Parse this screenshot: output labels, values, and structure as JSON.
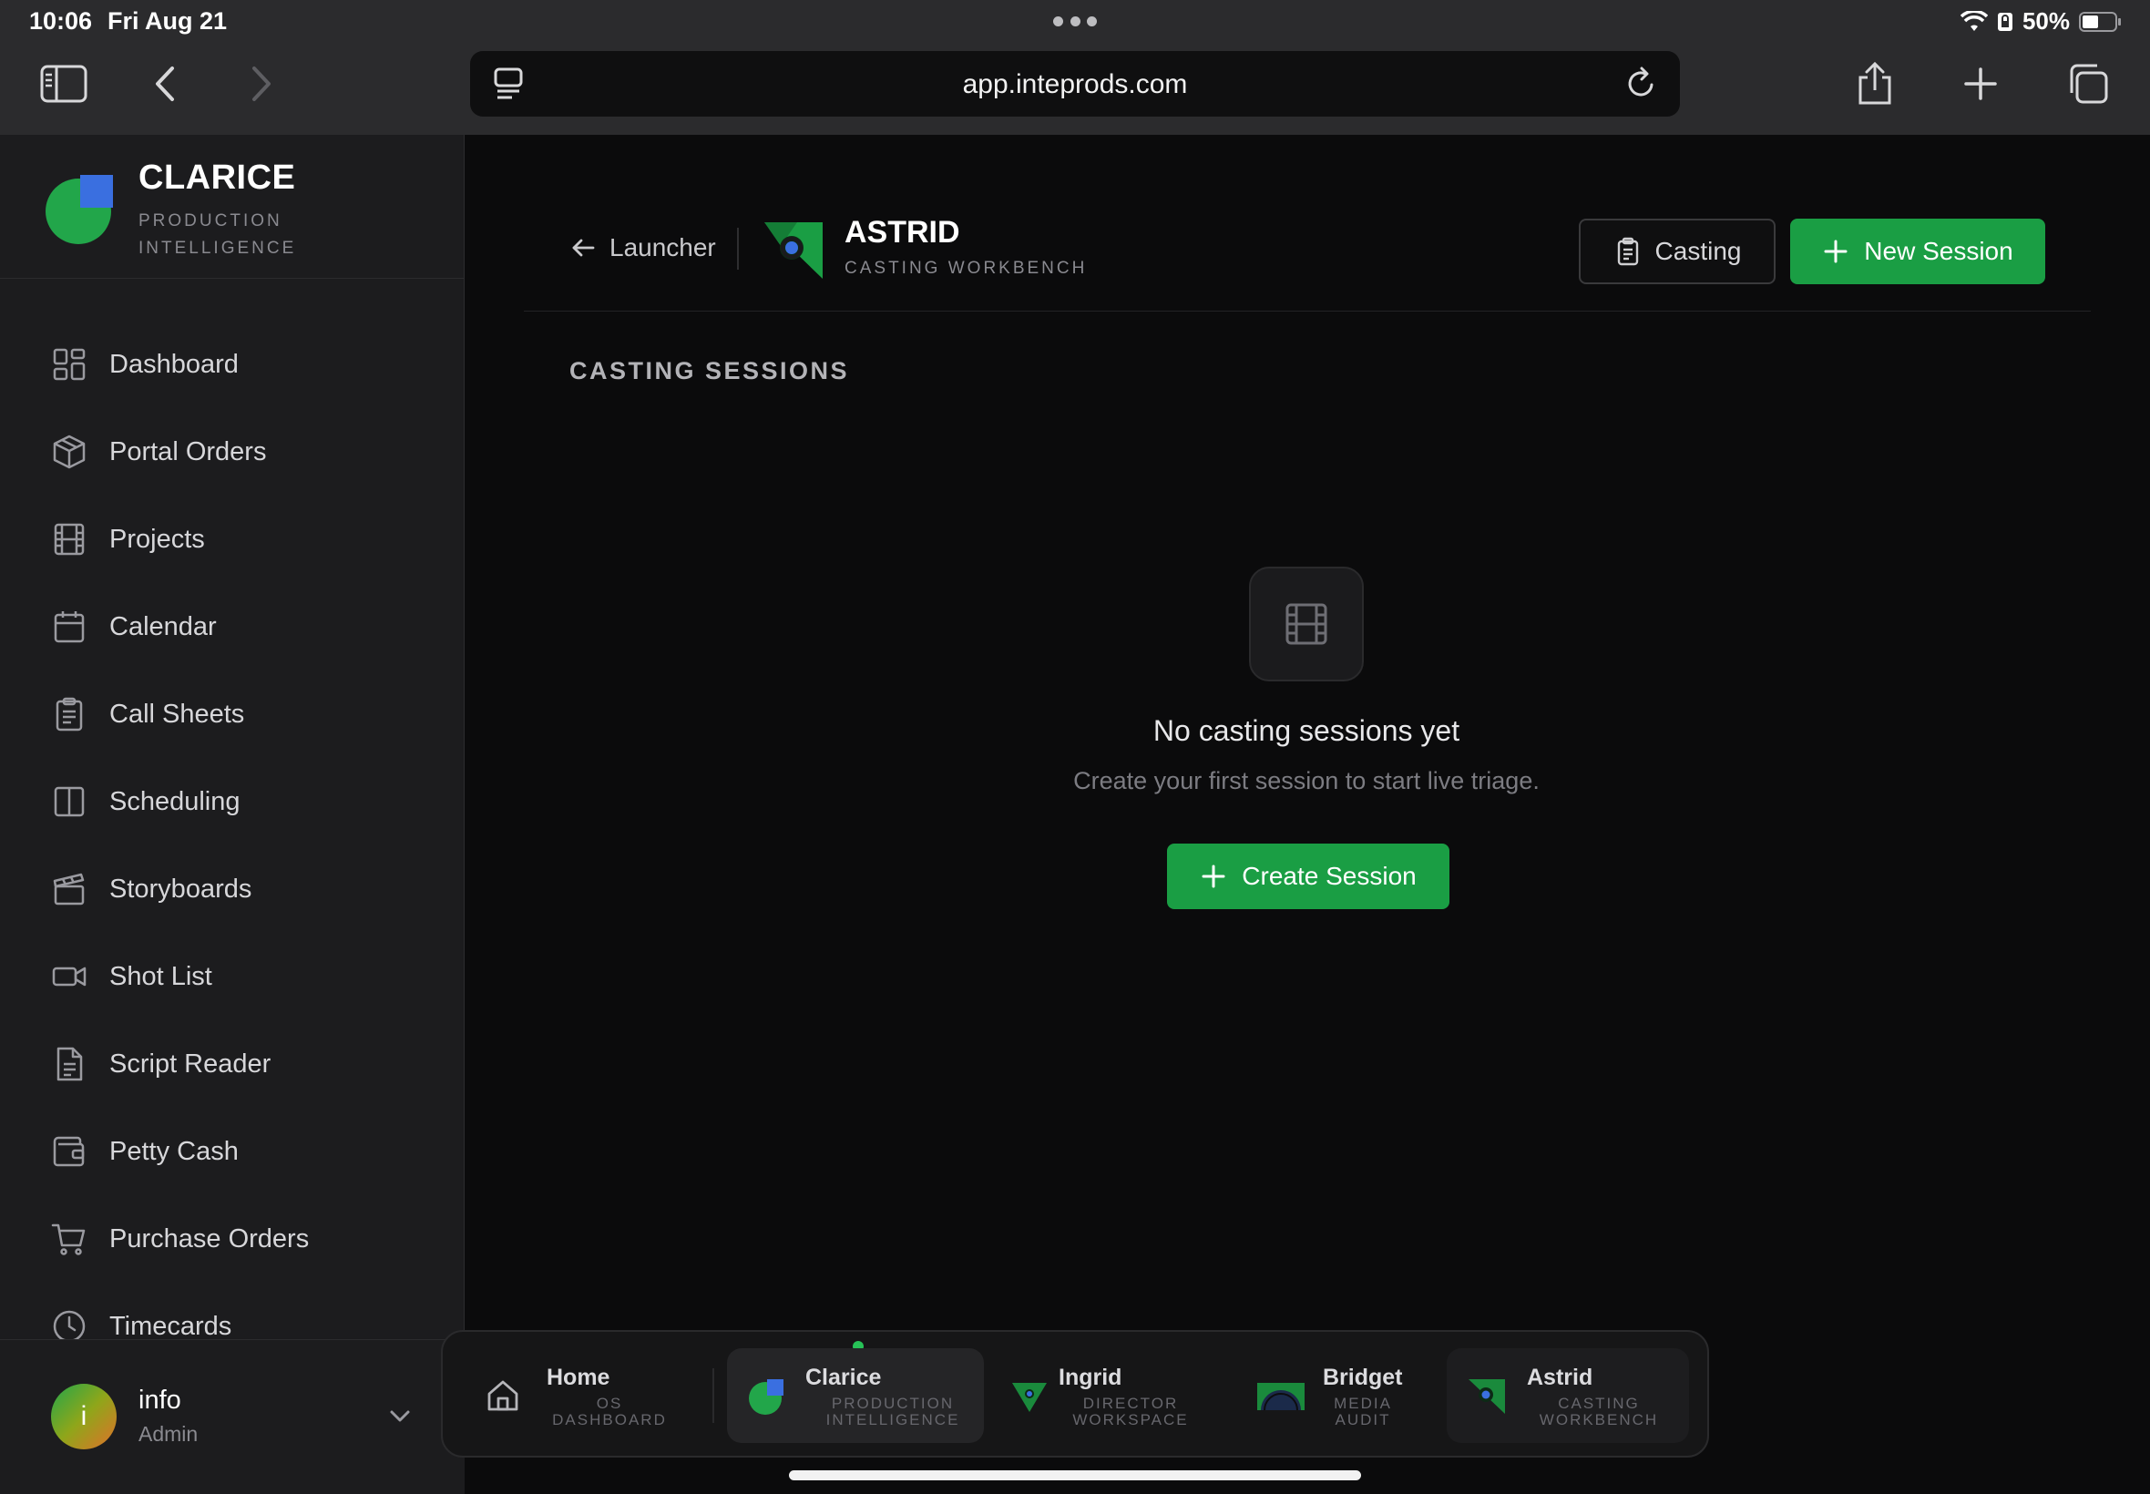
{
  "status_bar": {
    "time": "10:06",
    "date": "Fri Aug 21",
    "battery": "50%"
  },
  "browser": {
    "url": "app.inteprods.com"
  },
  "sidebar": {
    "brand_name": "CLARICE",
    "brand_sub": "PRODUCTION INTELLIGENCE",
    "items": [
      {
        "label": "Dashboard",
        "icon": "dashboard-icon"
      },
      {
        "label": "Portal Orders",
        "icon": "box-icon"
      },
      {
        "label": "Projects",
        "icon": "film-icon"
      },
      {
        "label": "Calendar",
        "icon": "calendar-icon"
      },
      {
        "label": "Call Sheets",
        "icon": "clipboard-icon"
      },
      {
        "label": "Scheduling",
        "icon": "columns-icon"
      },
      {
        "label": "Storyboards",
        "icon": "clapperboard-icon"
      },
      {
        "label": "Shot List",
        "icon": "video-icon"
      },
      {
        "label": "Script Reader",
        "icon": "document-icon"
      },
      {
        "label": "Petty Cash",
        "icon": "wallet-icon"
      },
      {
        "label": "Purchase Orders",
        "icon": "cart-icon"
      },
      {
        "label": "Timecards",
        "icon": "clock-icon"
      }
    ],
    "user": {
      "initial": "i",
      "name": "info",
      "role": "Admin"
    }
  },
  "header": {
    "back_label": "Launcher",
    "app_name": "ASTRID",
    "app_sub": "CASTING WORKBENCH",
    "casting_button": "Casting",
    "new_session_button": "New Session"
  },
  "main": {
    "section_title": "CASTING SESSIONS",
    "empty_title": "No casting sessions yet",
    "empty_subtitle": "Create your first session to start live triage.",
    "create_button": "Create Session"
  },
  "dock": {
    "items": [
      {
        "name": "Home",
        "sub": "OS DASHBOARD"
      },
      {
        "name": "Clarice",
        "sub": "PRODUCTION INTELLIGENCE"
      },
      {
        "name": "Ingrid",
        "sub": "DIRECTOR WORKSPACE"
      },
      {
        "name": "Bridget",
        "sub": "MEDIA AUDIT"
      },
      {
        "name": "Astrid",
        "sub": "CASTING WORKBENCH"
      }
    ]
  },
  "colors": {
    "accent_green": "#1a9e44",
    "brand_blue": "#3a6fe0"
  }
}
